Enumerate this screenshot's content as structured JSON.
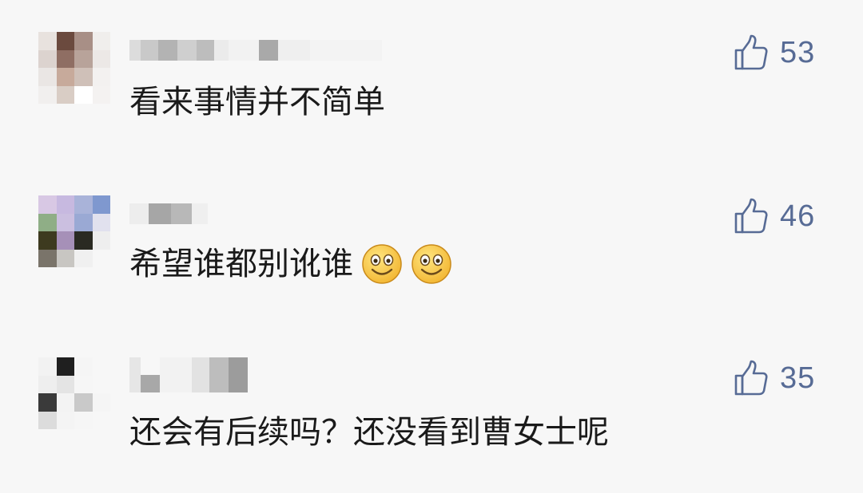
{
  "comments": [
    {
      "text": "看来事情并不简单",
      "likes": "53",
      "emoji_count": 0
    },
    {
      "text": "希望谁都别讹谁",
      "likes": "46",
      "emoji_count": 2,
      "emoji": "smile-emoji"
    },
    {
      "text": "还会有后续吗？还没看到曹女士呢",
      "likes": "35",
      "emoji_count": 0
    }
  ],
  "icons": {
    "like": "thumbs-up-icon"
  },
  "colors": {
    "background": "#f7f7f7",
    "like_accent": "#576b95",
    "text": "#1a1a1a"
  }
}
